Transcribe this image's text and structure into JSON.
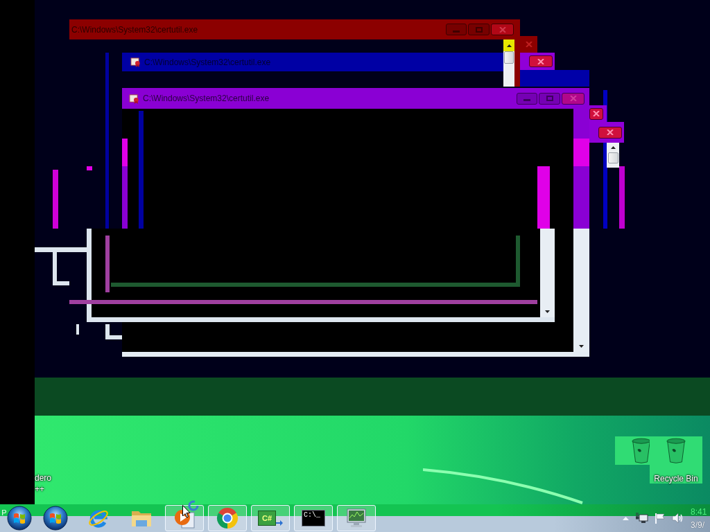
{
  "windows": [
    {
      "title": "C:\\Windows\\System32\\certutil.exe",
      "color": "#8c0000",
      "icon": false,
      "caption_buttons": true
    },
    {
      "title": "C:\\Windows\\System32\\certutil.exe",
      "color": "#0000a4",
      "icon": true,
      "caption_buttons": false
    },
    {
      "title": "C:\\Windows\\System32\\certutil.exe",
      "color": "#8a00d4",
      "icon": true,
      "caption_buttons": true
    }
  ],
  "desktop_icons": [
    {
      "kind": "program",
      "lines": [
        "dero",
        "++"
      ],
      "selected": false
    },
    {
      "kind": "recycle_bin",
      "label": "Recycle Bin",
      "selected": true
    }
  ],
  "taskbar": {
    "start_fragment": "P",
    "items": [
      {
        "kind": "orb",
        "running": false
      },
      {
        "kind": "ebrowser",
        "running": false
      },
      {
        "kind": "folder",
        "running": false
      },
      {
        "kind": "player",
        "running": true
      },
      {
        "kind": "circlelogo",
        "running": true
      },
      {
        "kind": "code",
        "text": "C#",
        "running": true
      },
      {
        "kind": "console",
        "text": "C:\\_",
        "running": true
      },
      {
        "kind": "monitor",
        "running": true
      }
    ],
    "clock": {
      "time": "8:41",
      "date": "3/9/"
    }
  }
}
